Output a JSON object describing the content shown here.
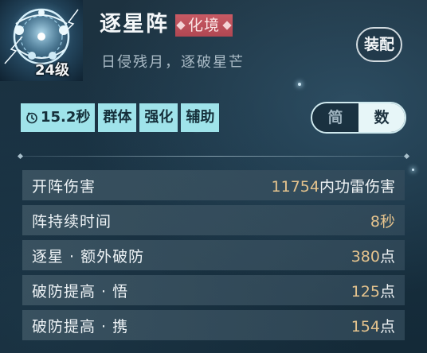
{
  "skill": {
    "name": "逐星阵",
    "realm": "化境",
    "subtitle": "日侵残月，逐破星芒",
    "level": "24级",
    "icon": "star-array-icon"
  },
  "equip_label": "装配",
  "tags": [
    {
      "label": "15.2秒",
      "icon": "clock-icon"
    },
    {
      "label": "群体"
    },
    {
      "label": "强化"
    },
    {
      "label": "辅助"
    }
  ],
  "mode_toggle": {
    "options": [
      "简",
      "数"
    ],
    "selected": "数"
  },
  "stats": [
    {
      "label": "开阵伤害",
      "value": "11754",
      "unit": "内功雷伤害"
    },
    {
      "label": "阵持续时间",
      "value": "8",
      "unit": "秒"
    },
    {
      "label": "逐星 · 额外破防",
      "value": "380",
      "unit": "点"
    },
    {
      "label": "破防提高 · 悟",
      "value": "125",
      "unit": "点"
    },
    {
      "label": "破防提高 · 携",
      "value": "154",
      "unit": "点"
    }
  ],
  "colors": {
    "tag_bg": "#9fe3ea",
    "realm_bg": "#c85a64",
    "value_gold": "#e6c48e"
  }
}
